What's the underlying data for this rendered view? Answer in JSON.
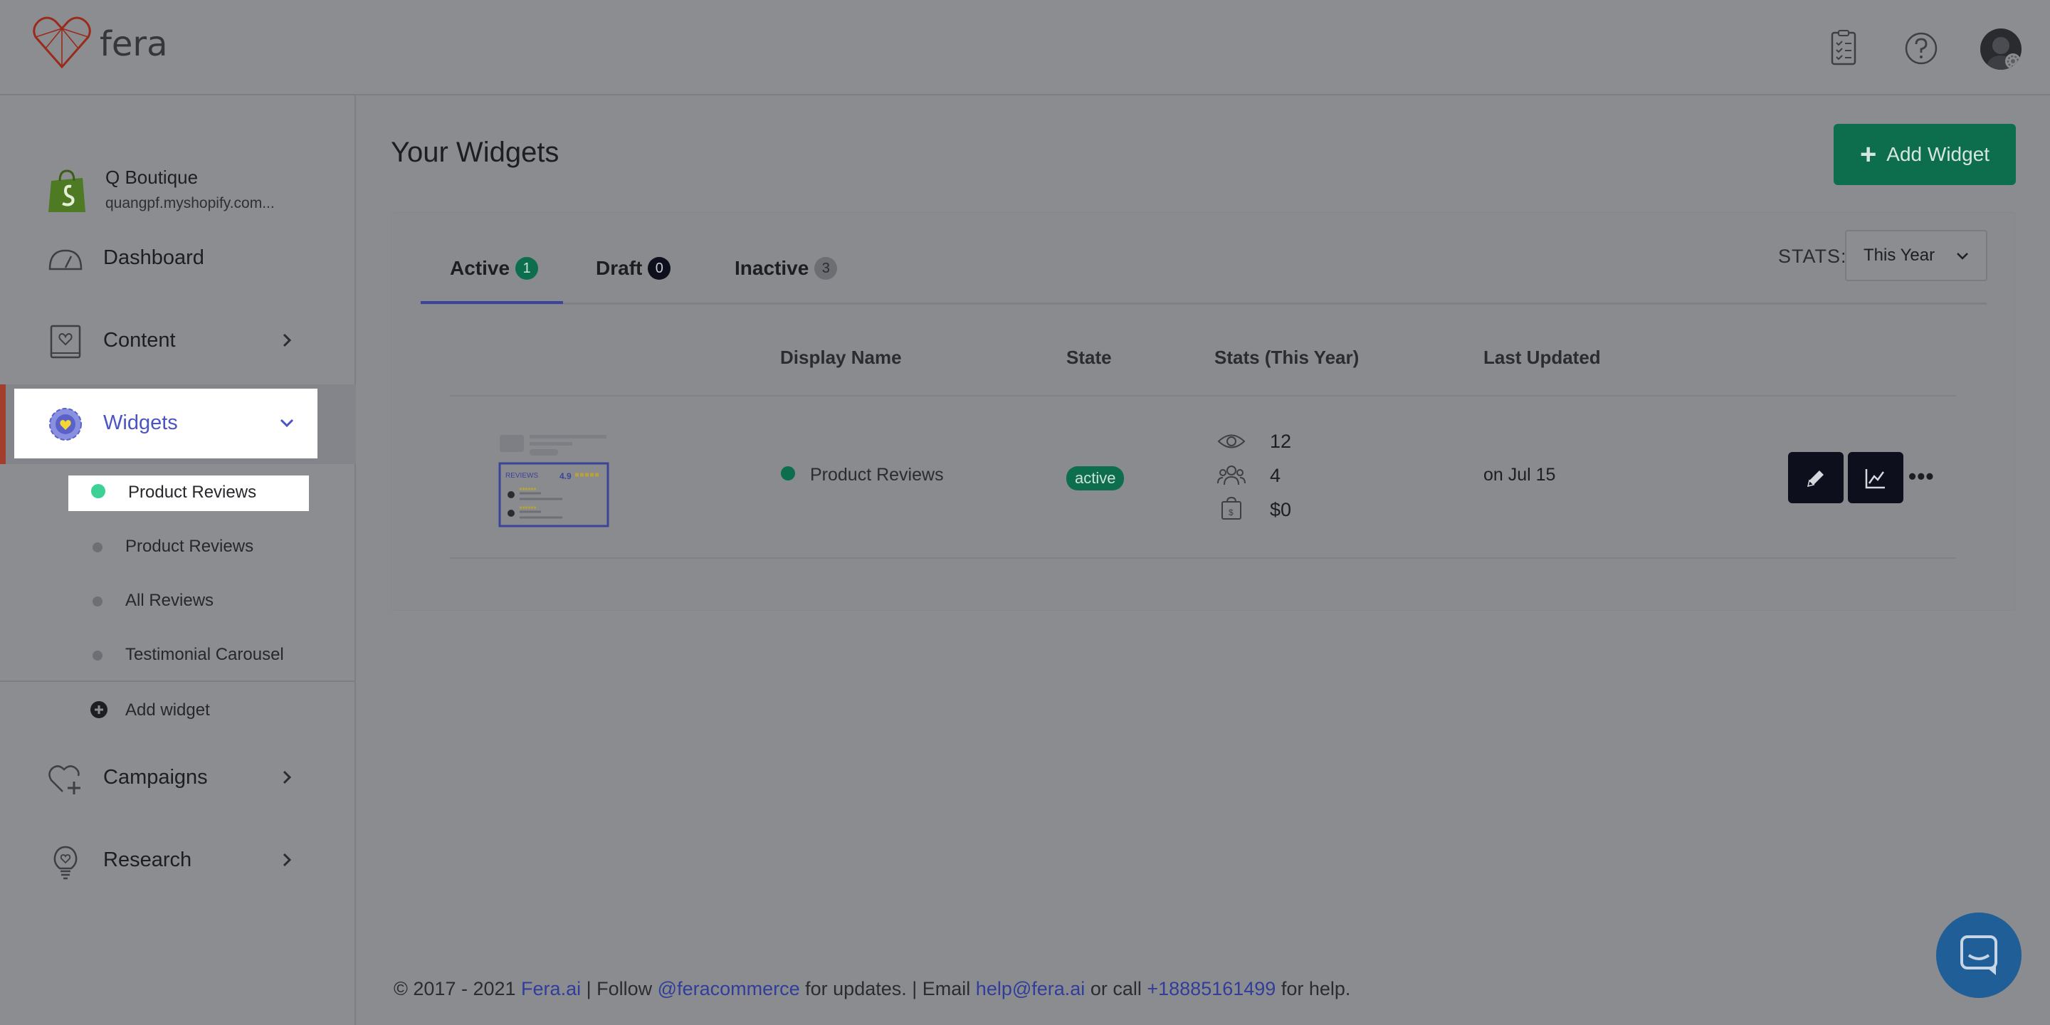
{
  "header": {
    "brand": "fera"
  },
  "sidebar": {
    "store": {
      "name": "Q Boutique",
      "domain": "quangpf.myshopify.com..."
    },
    "nav": [
      {
        "label": "Dashboard"
      },
      {
        "label": "Content"
      },
      {
        "label": "Widgets"
      },
      {
        "label": "Campaigns"
      },
      {
        "label": "Research"
      }
    ],
    "widgets": [
      {
        "label": "Product Reviews"
      },
      {
        "label": "Product Reviews"
      },
      {
        "label": "All Reviews"
      },
      {
        "label": "Testimonial Carousel"
      }
    ],
    "add_widget": "Add widget"
  },
  "main": {
    "title": "Your Widgets",
    "add_button": "Add Widget",
    "tabs": [
      {
        "label": "Active",
        "count": "1"
      },
      {
        "label": "Draft",
        "count": "0"
      },
      {
        "label": "Inactive",
        "count": "3"
      }
    ],
    "stats_label": "STATS:",
    "stats_period": "This Year",
    "columns": [
      "Display Name",
      "State",
      "Stats (This Year)",
      "Last Updated"
    ],
    "rows": [
      {
        "name": "Product Reviews",
        "state": "active",
        "views": "12",
        "visitors": "4",
        "revenue": "$0",
        "updated": "on Jul 15",
        "thumb_label": "REVIEWS",
        "thumb_score": "4.9"
      }
    ]
  },
  "footer": {
    "copy": "© 2017 - 2021",
    "site": "Fera.ai",
    "sep1": "|  Follow",
    "handle": "@feracommerce",
    "mid": "for updates.  |  Email",
    "email": "help@fera.ai",
    "or_call": "or call",
    "phone": "+18885161499",
    "end": "for help."
  },
  "colors": {
    "accent_green": "#0d6e4d",
    "accent_indigo": "#4a55c4",
    "overlay_gray": "#8b8d91"
  }
}
